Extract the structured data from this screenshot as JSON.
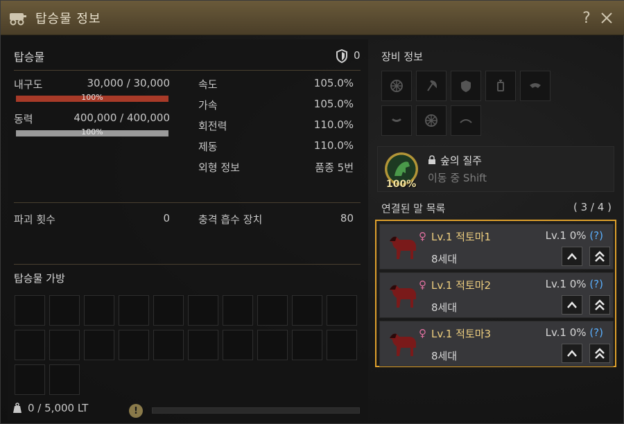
{
  "window": {
    "title": "탑승물 정보"
  },
  "mount": {
    "heading": "탑승물",
    "armor_count": "0",
    "durability": {
      "label": "내구도",
      "value": "30,000 / 30,000",
      "percent": "100%",
      "fraction": 1.0,
      "color": "#a83a28"
    },
    "stamina": {
      "label": "동력",
      "value": "400,000 / 400,000",
      "percent": "100%",
      "fraction": 1.0,
      "color": "#9a9a9a"
    },
    "stats": [
      {
        "label": "속도",
        "value": "105.0%"
      },
      {
        "label": "가속",
        "value": "105.0%"
      },
      {
        "label": "회전력",
        "value": "110.0%"
      },
      {
        "label": "제동",
        "value": "110.0%"
      },
      {
        "label": "외형 정보",
        "value": "품종 5번"
      }
    ],
    "destroy": {
      "label": "파괴 횟수",
      "value": "0"
    },
    "shock": {
      "label": "충격 흡수 장치",
      "value": "80"
    }
  },
  "bag": {
    "heading": "탑승물 가방",
    "slots": 22,
    "weight": "0 / 5,000 LT"
  },
  "equipment": {
    "heading": "장비 정보",
    "slots": [
      "wheel-icon",
      "axe-icon",
      "shield-icon",
      "lantern-icon",
      "mark-icon",
      "emblem-icon",
      "wheel-icon",
      "bow-icon"
    ]
  },
  "skill": {
    "name": "숲의 질주",
    "subtitle": "이동 중 Shift",
    "percent": "100%"
  },
  "horses": {
    "heading": "연결된 말 목록",
    "count": "( 3 / 4 )",
    "items": [
      {
        "gender": "♀",
        "name": "Lv.1 적토마1",
        "level": "Lv.1 0%",
        "help": "(?)",
        "generation": "8세대"
      },
      {
        "gender": "♀",
        "name": "Lv.1 적토마2",
        "level": "Lv.1 0%",
        "help": "(?)",
        "generation": "8세대"
      },
      {
        "gender": "♀",
        "name": "Lv.1 적토마3",
        "level": "Lv.1 0%",
        "help": "(?)",
        "generation": "8세대"
      }
    ]
  },
  "colors": {
    "accent": "#e0a12c",
    "titlebar": "#5a4a30",
    "horse_name": "#f0d080"
  }
}
